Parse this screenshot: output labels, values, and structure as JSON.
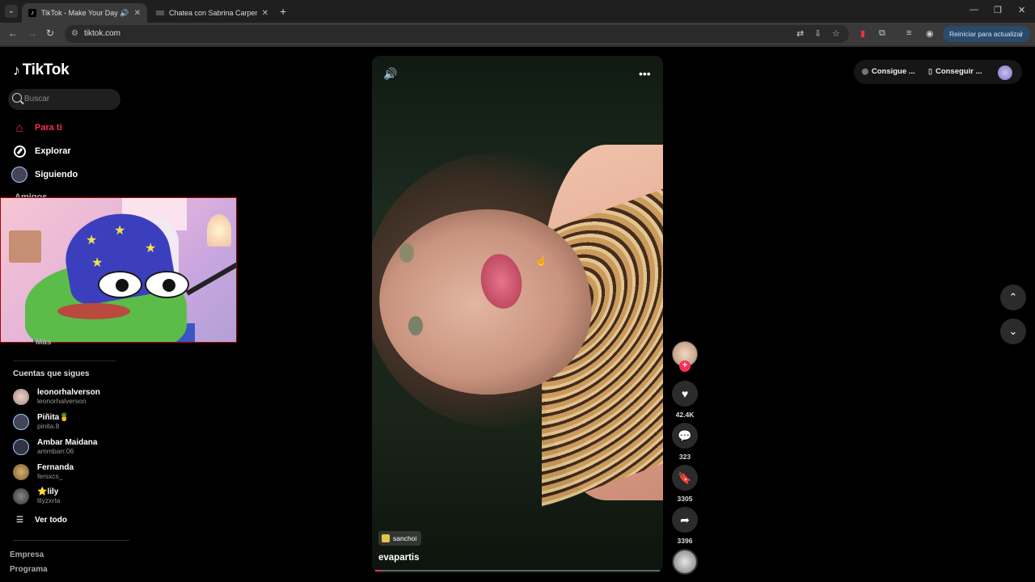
{
  "browser": {
    "tabs": [
      {
        "title": "TikTok - Make Your Day",
        "active": true
      },
      {
        "title": "Chatea con Sabrina Carpenter |",
        "active": false
      }
    ],
    "url": "tiktok.com",
    "update_button": "Reiniciar para actualizar"
  },
  "sidebar": {
    "logo": "TikTok",
    "search_placeholder": "Buscar",
    "nav": [
      {
        "label": "Para ti",
        "icon": "home-icon"
      },
      {
        "label": "Explorar",
        "icon": "compass-icon"
      },
      {
        "label": "Siguiendo",
        "icon": "avatar"
      }
    ],
    "partial_nav": "Amigos",
    "more_label": "Más",
    "following_title": "Cuentas que sigues",
    "following": [
      {
        "name": "leonorhalverson",
        "handle": "leonorhalverson"
      },
      {
        "name": "Piñita🍍",
        "handle": "pinita.8"
      },
      {
        "name": "Ambar Maidana",
        "handle": "ammbarr.06"
      },
      {
        "name": "Fernanda",
        "handle": "fersxcs_"
      },
      {
        "name": "⭐lily",
        "handle": "lilyzxrta"
      }
    ],
    "see_all": "Ver todo",
    "footer": [
      "Empresa",
      "Programa"
    ]
  },
  "video": {
    "tag": "sanchoi",
    "username": "evapartis",
    "progress": 0.02
  },
  "actions": {
    "likes": "42.4K",
    "comments": "323",
    "saves": "3305",
    "shares": "3396"
  },
  "top_right": {
    "get_coins": "Consigue ...",
    "get_app": "Conseguir ..."
  },
  "colors": {
    "accent": "#fe2c55"
  }
}
